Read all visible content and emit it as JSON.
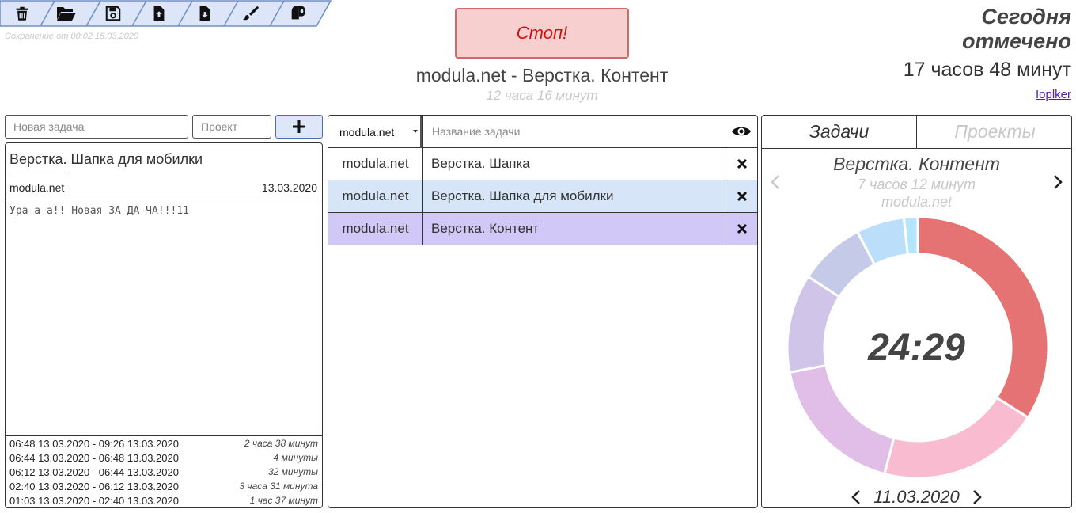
{
  "toolbar": {
    "buttons": [
      {
        "name": "trash-icon",
        "action": "clear"
      },
      {
        "name": "folder-open-icon",
        "action": "open"
      },
      {
        "name": "floppy-disk-icon",
        "action": "save"
      },
      {
        "name": "file-upload-icon",
        "action": "export"
      },
      {
        "name": "file-download-icon",
        "action": "import"
      },
      {
        "name": "paintbrush-icon",
        "action": "theme"
      },
      {
        "name": "toilet-paper-icon",
        "action": "misc"
      }
    ],
    "bg_color": "#dce6f8",
    "border_color": "#6f8fc8",
    "save_note": "Сохранение от 00:02 15.03.2020"
  },
  "stop_button": {
    "label": "Стоп!"
  },
  "current": {
    "title": "modula.net - Верстка. Контент",
    "time": "12 часа 16 минут"
  },
  "today": {
    "title": "Сегодня отмечено",
    "total": "17 часов 48 минут",
    "user": "Ioplker"
  },
  "new_task": {
    "task_placeholder": "Новая задача",
    "project_placeholder": "Проект"
  },
  "details": {
    "title": "Верстка. Шапка для мобилки",
    "project": "modula.net",
    "date": "13.03.2020",
    "note": "Ура-а-а!! Новая ЗА-ДА-ЧА!!!11",
    "log": [
      {
        "range": "06:48 13.03.2020 - 09:26 13.03.2020",
        "duration": "2 часа 38 минут"
      },
      {
        "range": "06:44 13.03.2020 - 06:48 13.03.2020",
        "duration": "4 минуты"
      },
      {
        "range": "06:12 13.03.2020 - 06:44 13.03.2020",
        "duration": "32 минуты"
      },
      {
        "range": "02:40 13.03.2020 - 06:12 13.03.2020",
        "duration": "3 часа 31 минута"
      },
      {
        "range": "01:03 13.03.2020 - 02:40 13.03.2020",
        "duration": "1 час 37 минут"
      }
    ]
  },
  "task_list": {
    "project_select": "modula.net",
    "name_placeholder": "Название задачи",
    "rows": [
      {
        "project": "modula.net",
        "name": "Верстка. Шапка",
        "bg": "#ffffff"
      },
      {
        "project": "modula.net",
        "name": "Верстка. Шапка для мобилки",
        "bg": "#d6e6f8"
      },
      {
        "project": "modula.net",
        "name": "Верстка. Контент",
        "bg": "#d2c8f8"
      }
    ]
  },
  "stats": {
    "tabs": [
      "Задачи",
      "Проекты"
    ],
    "selected_title": "Верстка. Контент",
    "selected_time": "7 часов 12 минут",
    "selected_project": "modula.net",
    "timer": "24:29",
    "date": "11.03.2020",
    "segments": [
      {
        "value": 120,
        "color": "#e57373"
      },
      {
        "value": 71,
        "color": "#f8bbd0"
      },
      {
        "value": 63,
        "color": "#e1bee7"
      },
      {
        "value": 43,
        "color": "#d1c4e9"
      },
      {
        "value": 29,
        "color": "#c5cae9"
      },
      {
        "value": 21,
        "color": "#bbdefb"
      },
      {
        "value": 6,
        "color": "#b3e5fc"
      }
    ]
  }
}
